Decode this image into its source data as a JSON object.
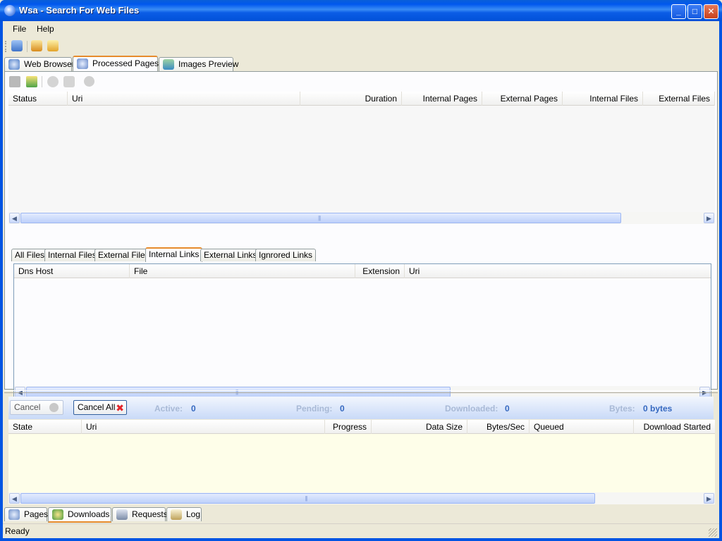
{
  "window": {
    "title": "Wsa - Search For Web Files"
  },
  "menu": [
    {
      "label": "File"
    },
    {
      "label": "Help"
    }
  ],
  "main_tabs": [
    {
      "label": "Web Browser"
    },
    {
      "label": "Processed Pages"
    },
    {
      "label": "Images Preview"
    }
  ],
  "pages_table": {
    "columns": [
      "Status",
      "Uri",
      "Duration",
      "Internal Pages",
      "External Pages",
      "Internal Files",
      "External Files"
    ]
  },
  "detail_tabs": [
    "All Files",
    "Internal Files",
    "External Files",
    "Internal Links",
    "External Links",
    "Ignrored Links"
  ],
  "links_table": {
    "columns": [
      "Dns Host",
      "File",
      "Extension",
      "Uri"
    ]
  },
  "downloads": {
    "cancel_label": "Cancel",
    "cancel_all_label": "Cancel All",
    "active_label": "Active:",
    "active_value": "0",
    "pending_label": "Pending:",
    "pending_value": "0",
    "downloaded_label": "Downloaded:",
    "downloaded_value": "0",
    "bytes_label": "Bytes:",
    "bytes_value": "0 bytes",
    "columns": [
      "State",
      "Uri",
      "Progress",
      "Data Size",
      "Bytes/Sec",
      "Queued",
      "Download Started"
    ]
  },
  "bottom_tabs": [
    {
      "label": "Pages"
    },
    {
      "label": "Downloads"
    },
    {
      "label": "Requests"
    },
    {
      "label": "Log"
    }
  ],
  "status": {
    "text": "Ready"
  },
  "colors": {
    "title_bar": "#0058ee",
    "active_tab_accent": "#e68b2c",
    "downloads_area": "#fefee9",
    "stat_value": "#3568c0"
  }
}
